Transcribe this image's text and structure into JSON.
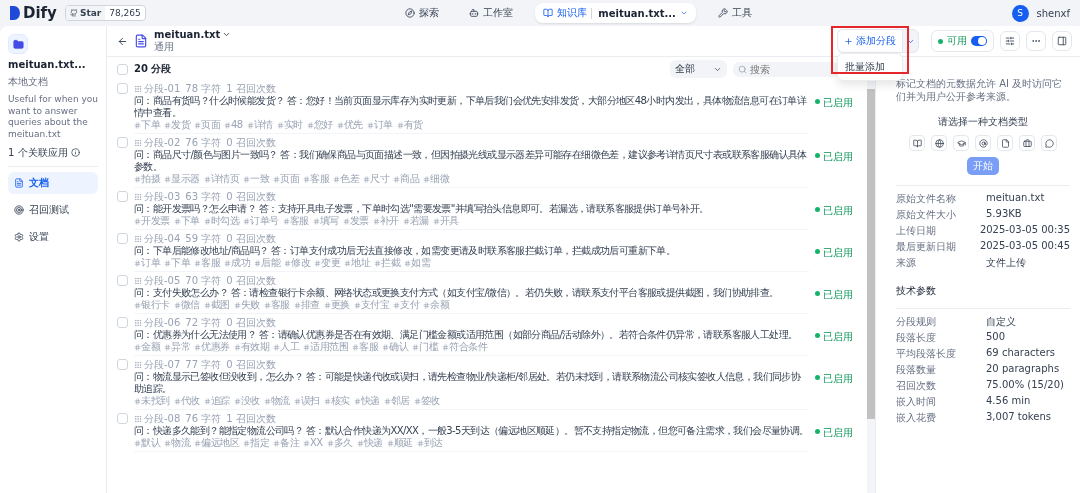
{
  "top_nav": {
    "logo": "Dify",
    "github": {
      "label": "Star",
      "count": "78,265"
    },
    "items": [
      {
        "label": "探索",
        "selected": false
      },
      {
        "label": "工作室",
        "selected": false
      },
      {
        "label": "知识库",
        "selected": true,
        "sub": "meituan.txt..."
      },
      {
        "label": "工具",
        "selected": false
      }
    ],
    "user": {
      "initial": "S",
      "name": "shenxf"
    }
  },
  "sidebar": {
    "name": "meituan.txt...",
    "type": "本地文档",
    "description": "Useful for when you want to answer queries about the meituan.txt",
    "linked_apps": "1 个关联应用",
    "items": [
      {
        "label": "文档",
        "selected": true
      },
      {
        "label": "召回测试",
        "selected": false
      },
      {
        "label": "设置",
        "selected": false
      }
    ]
  },
  "header": {
    "title": "meituan.txt",
    "subtitle": "通用",
    "add_button": "添加分段",
    "dropdown": [
      "批量添加"
    ],
    "status": {
      "label": "可用",
      "on": true
    }
  },
  "toolbar": {
    "select_all_checked": false,
    "count": "20 分段",
    "filter": "全部",
    "search": {
      "placeholder": "搜索"
    }
  },
  "segments": [
    {
      "id": "分段-01",
      "chars": "78 字符",
      "hits": "1 召回次数",
      "text": "问：商品有货吗？什么时候能发货？ 答：您好！当前页面显示库存为实时更新，下单后我们会优先安排发货，大部分地区48小时内发出，具体物流信息可在订单详情中查看。",
      "tags": [
        "下单",
        "发货",
        "页面",
        "48",
        "详情",
        "实时",
        "您好",
        "优先",
        "订单",
        "有货"
      ],
      "status": "已启用",
      "enabled": true,
      "checked": false
    },
    {
      "id": "分段-02",
      "chars": "76 字符",
      "hits": "0 召回次数",
      "text": "问：商品尺寸/颜色与图片一致吗？ 答：我们确保商品与页面描述一致，但因拍摄光线或显示器差异可能存在细微色差，建议参考详情页尺寸表或联系客服确认具体参数。",
      "tags": [
        "拍摄",
        "显示器",
        "详情页",
        "一致",
        "页面",
        "客服",
        "色差",
        "尺寸",
        "商品",
        "细微"
      ],
      "status": "已启用",
      "enabled": true,
      "checked": false
    },
    {
      "id": "分段-03",
      "chars": "63 字符",
      "hits": "0 召回次数",
      "text": "问：能开发票吗？怎么申请？ 答：支持开具电子发票，下单时勾选\"需要发票\"并填写抬头信息即可。若漏选，请联系客服提供订单号补开。",
      "tags": [
        "开发票",
        "下单",
        "时勾选",
        "订单号",
        "客服",
        "填写",
        "发票",
        "补开",
        "若漏",
        "开具"
      ],
      "status": "已启用",
      "enabled": true,
      "checked": false
    },
    {
      "id": "分段-04",
      "chars": "59 字符",
      "hits": "0 召回次数",
      "text": "问：下单后能修改地址/商品吗？ 答：订单支付成功后无法直接修改，如需变更请及时联系客服拦截订单，拦截成功后可重新下单。",
      "tags": [
        "订单",
        "下单",
        "客服",
        "成功",
        "后能",
        "修改",
        "变更",
        "地址",
        "拦截",
        "如需"
      ],
      "status": "已启用",
      "enabled": true,
      "checked": false
    },
    {
      "id": "分段-05",
      "chars": "70 字符",
      "hits": "0 召回次数",
      "text": "问：支付失败怎么办？ 答：请检查银行卡余额、网络状态或更换支付方式（如支付宝/微信）。若仍失败，请联系支付平台客服或提供截图，我们协助排查。",
      "tags": [
        "银行卡",
        "微信",
        "截图",
        "失败",
        "客服",
        "排查",
        "更换",
        "支付宝",
        "支付",
        "余额"
      ],
      "status": "已启用",
      "enabled": true,
      "checked": false
    },
    {
      "id": "分段-06",
      "chars": "72 字符",
      "hits": "0 召回次数",
      "text": "问：优惠券为什么无法使用？ 答：请确认优惠券是否在有效期、满足门槛金额或适用范围（如部分商品/活动除外）。若符合条件仍异常，请联系客服人工处理。",
      "tags": [
        "金额",
        "异常",
        "优惠券",
        "有效期",
        "人工",
        "适用范围",
        "客服",
        "确认",
        "门槛",
        "符合条件"
      ],
      "status": "已启用",
      "enabled": true,
      "checked": false
    },
    {
      "id": "分段-07",
      "chars": "77 字符",
      "hits": "0 召回次数",
      "text": "问：物流显示已签收但没收到，怎么办？ 答：可能是快递代收或误扫，请先检查物业/快递柜/邻居处。若仍未找到，请联系物流公司核实签收人信息，我们同步协助追踪。",
      "tags": [
        "未找到",
        "代收",
        "追踪",
        "没收",
        "物流",
        "误扫",
        "核实",
        "快递",
        "邻居",
        "签收"
      ],
      "status": "已启用",
      "enabled": true,
      "checked": false
    },
    {
      "id": "分段-08",
      "chars": "76 字符",
      "hits": "1 召回次数",
      "text": "问：快递多久能到？能指定物流公司吗？ 答：默认合作快递为XX/XX，一般3-5天到达（偏远地区顺延）。暂不支持指定物流，但您可备注需求，我们会尽量协调。",
      "tags": [
        "默认",
        "物流",
        "偏远地区",
        "指定",
        "备注",
        "XX",
        "多久",
        "快递",
        "顺延",
        "到达"
      ],
      "status": "已启用",
      "enabled": true,
      "checked": false
    }
  ],
  "metadata": {
    "description": "标记文档的元数据允许 AI 及时访问它们并为用户公开参考来源。",
    "prompt": "请选择一种文档类型",
    "start_button": {
      "label": "开始",
      "disabled": true
    }
  },
  "file_info": [
    {
      "label": "原始文件名称",
      "value": "meituan.txt"
    },
    {
      "label": "原始文件大小",
      "value": "5.93KB"
    },
    {
      "label": "上传日期",
      "value": "2025-03-05 00:35"
    },
    {
      "label": "最后更新日期",
      "value": "2025-03-05 00:45"
    },
    {
      "label": "来源",
      "value": "文件上传"
    }
  ],
  "tech_params": {
    "title": "技术参数",
    "rows": [
      {
        "label": "分段规则",
        "value": "自定义"
      },
      {
        "label": "段落长度",
        "value": "500"
      },
      {
        "label": "平均段落长度",
        "value": "69 characters"
      },
      {
        "label": "段落数量",
        "value": "20 paragraphs"
      },
      {
        "label": "召回次数",
        "value": "75.00% (15/20)"
      },
      {
        "label": "嵌入时间",
        "value": "4.56 min"
      },
      {
        "label": "嵌入花费",
        "value": "3,007 tokens"
      }
    ]
  }
}
